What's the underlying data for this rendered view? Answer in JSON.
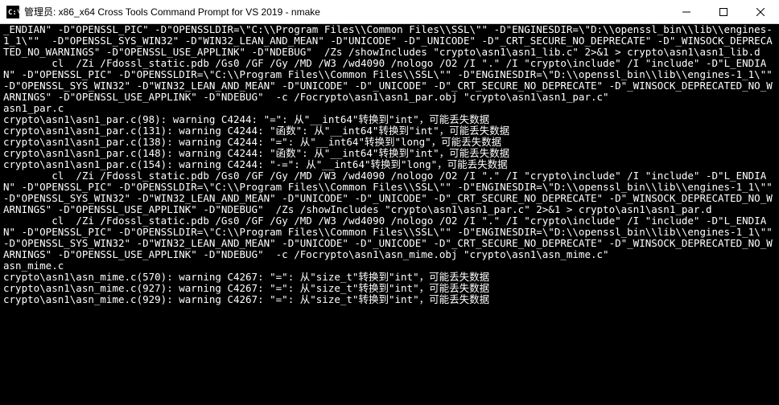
{
  "titlebar": {
    "title": "管理员: x86_x64 Cross Tools Command Prompt for VS 2019 - nmake"
  },
  "terminal": {
    "lines": [
      "_ENDIAN\" -D\"OPENSSL_PIC\" -D\"OPENSSLDIR=\\\"C:\\\\Program Files\\\\Common Files\\\\SSL\\\"\" -D\"ENGINESDIR=\\\"D:\\\\openssl_bin\\\\lib\\\\engines-1_1\\\"\"  -D\"OPENSSL_SYS_WIN32\" -D\"WIN32_LEAN_AND_MEAN\" -D\"UNICODE\" -D\"_UNICODE\" -D\"_CRT_SECURE_NO_DEPRECATE\" -D\"_WINSOCK_DEPRECATED_NO_WARNINGS\" -D\"OPENSSL_USE_APPLINK\" -D\"NDEBUG\"  /Zs /showIncludes \"crypto\\asn1\\asn1_lib.c\" 2>&1 > crypto\\asn1\\asn1_lib.d",
      "        cl  /Zi /Fdossl_static.pdb /Gs0 /GF /Gy /MD /W3 /wd4090 /nologo /O2 /I \".\" /I \"crypto\\include\" /I \"include\" -D\"L_ENDIAN\" -D\"OPENSSL_PIC\" -D\"OPENSSLDIR=\\\"C:\\\\Program Files\\\\Common Files\\\\SSL\\\"\" -D\"ENGINESDIR=\\\"D:\\\\openssl_bin\\\\lib\\\\engines-1_1\\\"\"  -D\"OPENSSL_SYS_WIN32\" -D\"WIN32_LEAN_AND_MEAN\" -D\"UNICODE\" -D\"_UNICODE\" -D\"_CRT_SECURE_NO_DEPRECATE\" -D\"_WINSOCK_DEPRECATED_NO_WARNINGS\" -D\"OPENSSL_USE_APPLINK\" -D\"NDEBUG\"  -c /Focrypto\\asn1\\asn1_par.obj \"crypto\\asn1\\asn1_par.c\"",
      "asn1_par.c",
      "crypto\\asn1\\asn1_par.c(98): warning C4244: \"=\": 从\"__int64\"转换到\"int\"，可能丢失数据",
      "crypto\\asn1\\asn1_par.c(131): warning C4244: \"函数\": 从\"__int64\"转换到\"int\"，可能丢失数据",
      "crypto\\asn1\\asn1_par.c(138): warning C4244: \"=\": 从\"__int64\"转换到\"long\"，可能丢失数据",
      "crypto\\asn1\\asn1_par.c(148): warning C4244: \"函数\": 从\"__int64\"转换到\"int\"，可能丢失数据",
      "crypto\\asn1\\asn1_par.c(154): warning C4244: \"-=\": 从\"__int64\"转换到\"long\"，可能丢失数据",
      "        cl  /Zi /Fdossl_static.pdb /Gs0 /GF /Gy /MD /W3 /wd4090 /nologo /O2 /I \".\" /I \"crypto\\include\" /I \"include\" -D\"L_ENDIAN\" -D\"OPENSSL_PIC\" -D\"OPENSSLDIR=\\\"C:\\\\Program Files\\\\Common Files\\\\SSL\\\"\" -D\"ENGINESDIR=\\\"D:\\\\openssl_bin\\\\lib\\\\engines-1_1\\\"\"  -D\"OPENSSL_SYS_WIN32\" -D\"WIN32_LEAN_AND_MEAN\" -D\"UNICODE\" -D\"_UNICODE\" -D\"_CRT_SECURE_NO_DEPRECATE\" -D\"_WINSOCK_DEPRECATED_NO_WARNINGS\" -D\"OPENSSL_USE_APPLINK\" -D\"NDEBUG\"  /Zs /showIncludes \"crypto\\asn1\\asn1_par.c\" 2>&1 > crypto\\asn1\\asn1_par.d",
      "        cl  /Zi /Fdossl_static.pdb /Gs0 /GF /Gy /MD /W3 /wd4090 /nologo /O2 /I \".\" /I \"crypto\\include\" /I \"include\" -D\"L_ENDIAN\" -D\"OPENSSL_PIC\" -D\"OPENSSLDIR=\\\"C:\\\\Program Files\\\\Common Files\\\\SSL\\\"\" -D\"ENGINESDIR=\\\"D:\\\\openssl_bin\\\\lib\\\\engines-1_1\\\"\"  -D\"OPENSSL_SYS_WIN32\" -D\"WIN32_LEAN_AND_MEAN\" -D\"UNICODE\" -D\"_UNICODE\" -D\"_CRT_SECURE_NO_DEPRECATE\" -D\"_WINSOCK_DEPRECATED_NO_WARNINGS\" -D\"OPENSSL_USE_APPLINK\" -D\"NDEBUG\"  -c /Focrypto\\asn1\\asn_mime.obj \"crypto\\asn1\\asn_mime.c\"",
      "asn_mime.c",
      "crypto\\asn1\\asn_mime.c(570): warning C4267: \"=\": 从\"size_t\"转换到\"int\"，可能丢失数据",
      "crypto\\asn1\\asn_mime.c(927): warning C4267: \"=\": 从\"size_t\"转换到\"int\"，可能丢失数据",
      "crypto\\asn1\\asn_mime.c(929): warning C4267: \"=\": 从\"size_t\"转换到\"int\"，可能丢失数据"
    ]
  }
}
